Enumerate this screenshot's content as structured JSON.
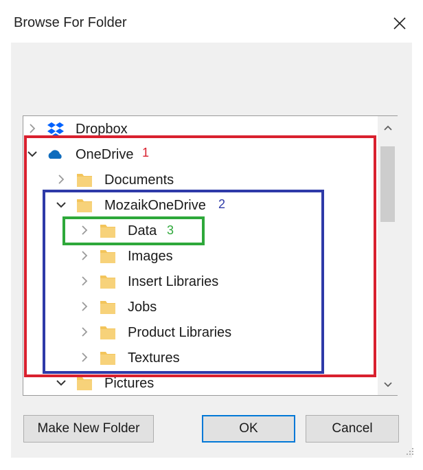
{
  "dialog": {
    "title": "Browse For Folder",
    "close_icon": "close-x-icon"
  },
  "tree": {
    "rows": [
      {
        "label": "Dropbox",
        "icon": "dropbox-icon",
        "expander": "chevron-right",
        "level": 0
      },
      {
        "label": "OneDrive",
        "icon": "cloud-icon",
        "expander": "chevron-down",
        "level": 0
      },
      {
        "label": "Documents",
        "icon": "folder-icon",
        "expander": "chevron-right",
        "level": 1
      },
      {
        "label": "MozaikOneDrive",
        "icon": "folder-icon",
        "expander": "chevron-down",
        "level": 1
      },
      {
        "label": "Data",
        "icon": "folder-icon",
        "expander": "chevron-right",
        "level": 2
      },
      {
        "label": "Images",
        "icon": "folder-icon",
        "expander": "chevron-right",
        "level": 2
      },
      {
        "label": "Insert Libraries",
        "icon": "folder-icon",
        "expander": "chevron-right",
        "level": 2
      },
      {
        "label": "Jobs",
        "icon": "folder-icon",
        "expander": "chevron-right",
        "level": 2
      },
      {
        "label": "Product Libraries",
        "icon": "folder-icon",
        "expander": "chevron-right",
        "level": 2
      },
      {
        "label": "Textures",
        "icon": "folder-icon",
        "expander": "chevron-right",
        "level": 2
      },
      {
        "label": "Pictures",
        "icon": "folder-icon",
        "expander": "chevron-down",
        "level": 1
      }
    ]
  },
  "annotations": [
    {
      "number": "1",
      "color": "#d9202e"
    },
    {
      "number": "2",
      "color": "#2e3aa8"
    },
    {
      "number": "3",
      "color": "#2ea83a"
    }
  ],
  "buttons": {
    "make_new_folder": "Make New Folder",
    "ok": "OK",
    "cancel": "Cancel"
  },
  "colors": {
    "folder": "#f3c55b",
    "onedrive": "#0f6cbd",
    "dropbox": "#0061fe",
    "focus": "#0078d7"
  }
}
